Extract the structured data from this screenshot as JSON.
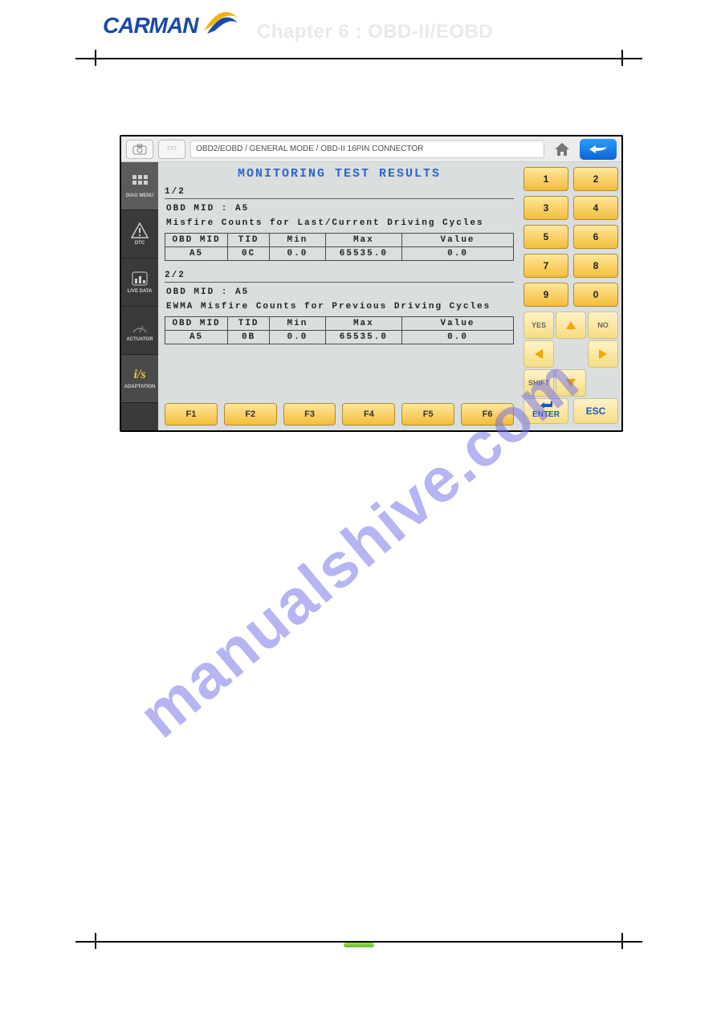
{
  "logo_text": "CARMAN",
  "chapter_heading": "Chapter 6 : OBD-II/EOBD",
  "breadcrumb": "OBD2/EOBD / GENERAL MODE / OBD-II 16PIN CONNECTOR",
  "screen_title": "MONITORING TEST RESULTS",
  "rail": [
    {
      "label": "DIAG MENU"
    },
    {
      "label": "DTC"
    },
    {
      "label": "LIVE DATA"
    },
    {
      "label": "ACTUATOR"
    },
    {
      "label": "ADAPTATION",
      "glyph": "i/s"
    }
  ],
  "groups": [
    {
      "index": "1/2",
      "mid_line": "OBD MID : A5",
      "desc": "Misfire Counts for Last/Current Driving Cycles",
      "headers": [
        "OBD MID",
        "TID",
        "Min",
        "Max",
        "Value"
      ],
      "row": [
        "A5",
        "0C",
        "0.0",
        "65535.0",
        "0.0"
      ]
    },
    {
      "index": "2/2",
      "mid_line": "OBD MID : A5",
      "desc": "EWMA Misfire Counts for Previous Driving Cycles",
      "headers": [
        "OBD MID",
        "TID",
        "Min",
        "Max",
        "Value"
      ],
      "row": [
        "A5",
        "0B",
        "0.0",
        "65535.0",
        "0.0"
      ]
    }
  ],
  "fn": [
    "F1",
    "F2",
    "F3",
    "F4",
    "F5",
    "F6"
  ],
  "numpad": [
    "1",
    "2",
    "3",
    "4",
    "5",
    "6",
    "7",
    "8",
    "9",
    "0"
  ],
  "dpad": {
    "yes": "YES",
    "no": "NO",
    "shift": "SHIFT"
  },
  "enter": "ENTER",
  "esc": "ESC",
  "watermark": "manualshive.com"
}
